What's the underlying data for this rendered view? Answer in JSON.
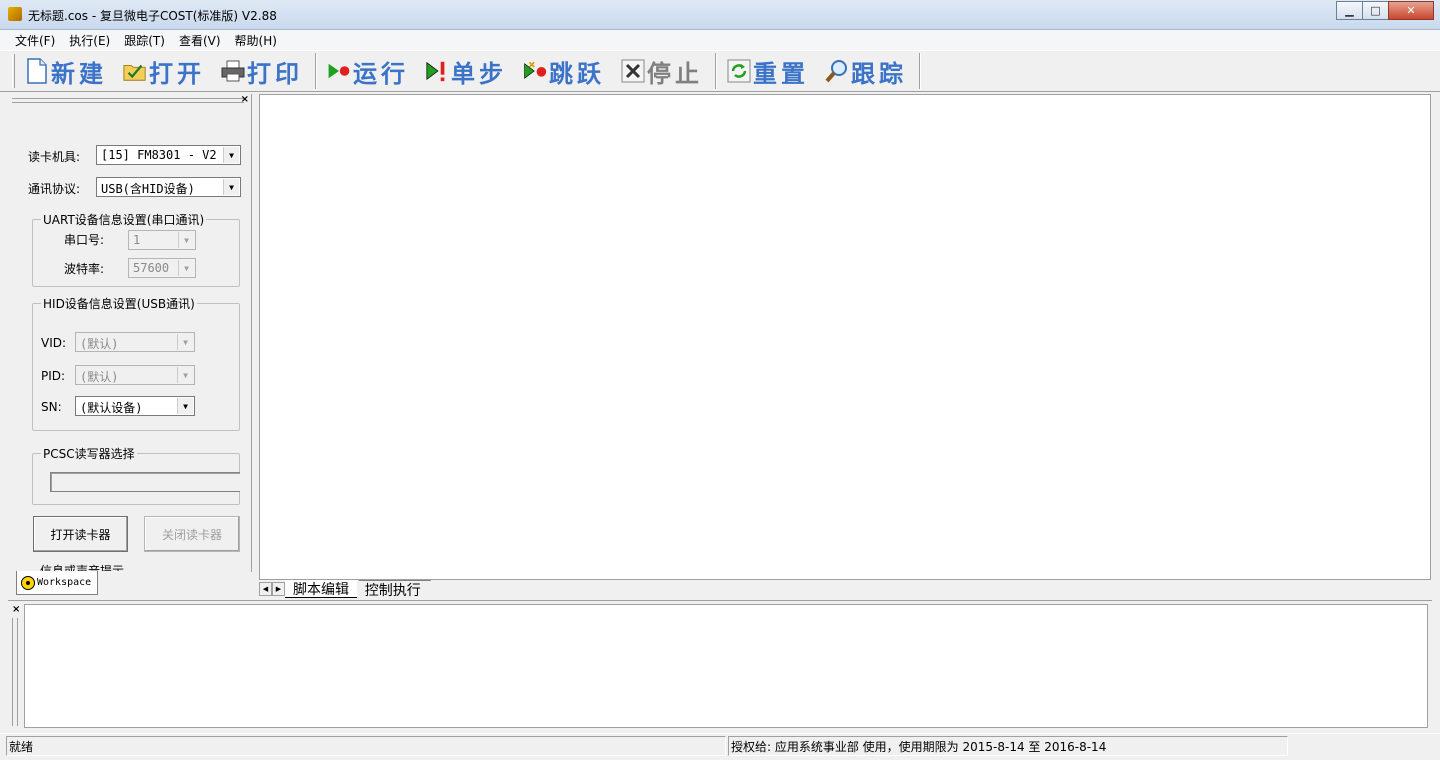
{
  "window": {
    "title": "无标题.cos - 复旦微电子COST(标准版) V2.88",
    "buttons": {
      "minimize": "▁",
      "maximize": "□",
      "close": "✕"
    }
  },
  "menu": [
    {
      "label": "文件(F)"
    },
    {
      "label": "执行(E)"
    },
    {
      "label": "跟踪(T)"
    },
    {
      "label": "查看(V)"
    },
    {
      "label": "帮助(H)"
    }
  ],
  "toolbar": {
    "new": "新建",
    "open": "打开",
    "print": "打印",
    "run": "运行",
    "step": "单步",
    "jump": "跳跃",
    "stop": "停止",
    "reset": "重置",
    "trace": "跟踪"
  },
  "workspace": {
    "close": "×",
    "reader_label": "读卡机具:",
    "reader_value": "[15] FM8301 - V2",
    "protocol_label": "通讯协议:",
    "protocol_value": "USB(含HID设备)",
    "uart_group": "UART设备信息设置(串口通讯)",
    "port_label": "串口号:",
    "port_value": "1",
    "baud_label": "波特率:",
    "baud_value": "57600",
    "hid_group": "HID设备信息设置(USB通讯)",
    "vid_label": "VID:",
    "vid_value": "(默认)",
    "pid_label": "PID:",
    "pid_value": "(默认)",
    "sn_label": "SN:",
    "sn_value": "(默认设备)",
    "pcsc_group": "PCSC读写器选择",
    "open_reader": "打开读卡器",
    "close_reader": "关闭读卡器",
    "cutoff_text": "信息或声音提示",
    "tab_label": "Workspace"
  },
  "editor_tabs": [
    {
      "label": "脚本编辑",
      "active": true
    },
    {
      "label": "控制执行",
      "active": false
    }
  ],
  "output": {
    "close": "×"
  },
  "status": {
    "ready": "就绪",
    "license": "授权给: 应用系统事业部 使用，使用期限为 2015-8-14 至 2016-8-14"
  },
  "colors": {
    "toolbar_text": "#3a73c8",
    "toolbar_disabled": "#808080",
    "run_green": "#1fa01f",
    "stop_red": "#e02020"
  }
}
